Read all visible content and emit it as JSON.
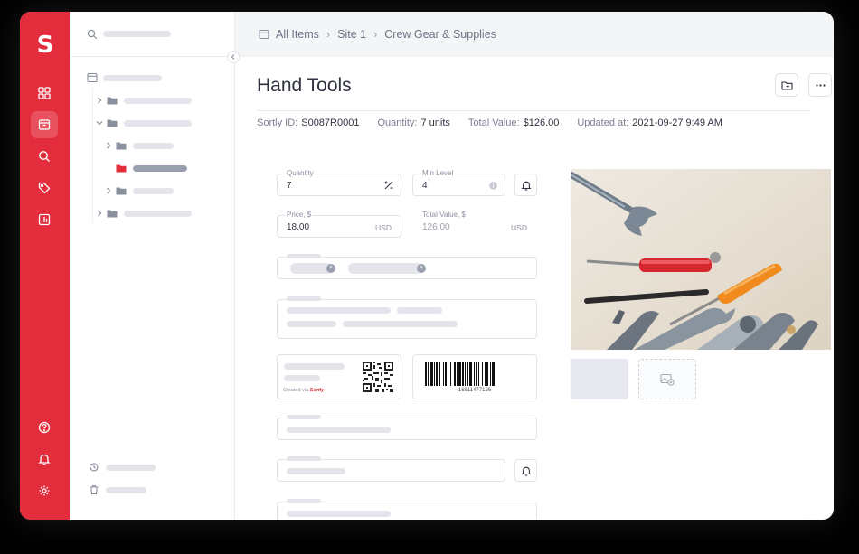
{
  "brand": {
    "logo_letter": "S",
    "accent": "#e32d3c"
  },
  "rail": {
    "items": [
      {
        "icon": "dashboard-icon"
      },
      {
        "icon": "items-box-icon",
        "active": true
      },
      {
        "icon": "search-icon"
      },
      {
        "icon": "tags-icon"
      },
      {
        "icon": "reports-icon"
      }
    ],
    "bottom": [
      {
        "icon": "help-icon"
      },
      {
        "icon": "bell-icon"
      },
      {
        "icon": "settings-gear-icon"
      }
    ]
  },
  "breadcrumb": {
    "items": [
      "All Items",
      "Site 1",
      "Crew Gear & Supplies"
    ]
  },
  "item": {
    "title": "Hand Tools",
    "meta": {
      "sortly_id_label": "Sortly ID:",
      "sortly_id": "S0087R0001",
      "quantity_label": "Quantity:",
      "quantity": "7 units",
      "total_value_label": "Total Value:",
      "total_value": "$126.00",
      "updated_label": "Updated at:",
      "updated": "2021-09-27 9:49 AM"
    },
    "fields": {
      "quantity_label": "Quantity",
      "quantity_value": "7",
      "min_level_label": "Min Level",
      "min_level_value": "4",
      "price_label": "Price, $",
      "price_value": "18.00",
      "price_unit": "USD",
      "total_label": "Total Value, $",
      "total_value": "126.00",
      "total_unit": "USD"
    },
    "qr": {
      "created_prefix": "Created via",
      "created_brand": "Sortly"
    },
    "barcode": {
      "number": "16811477126"
    }
  }
}
